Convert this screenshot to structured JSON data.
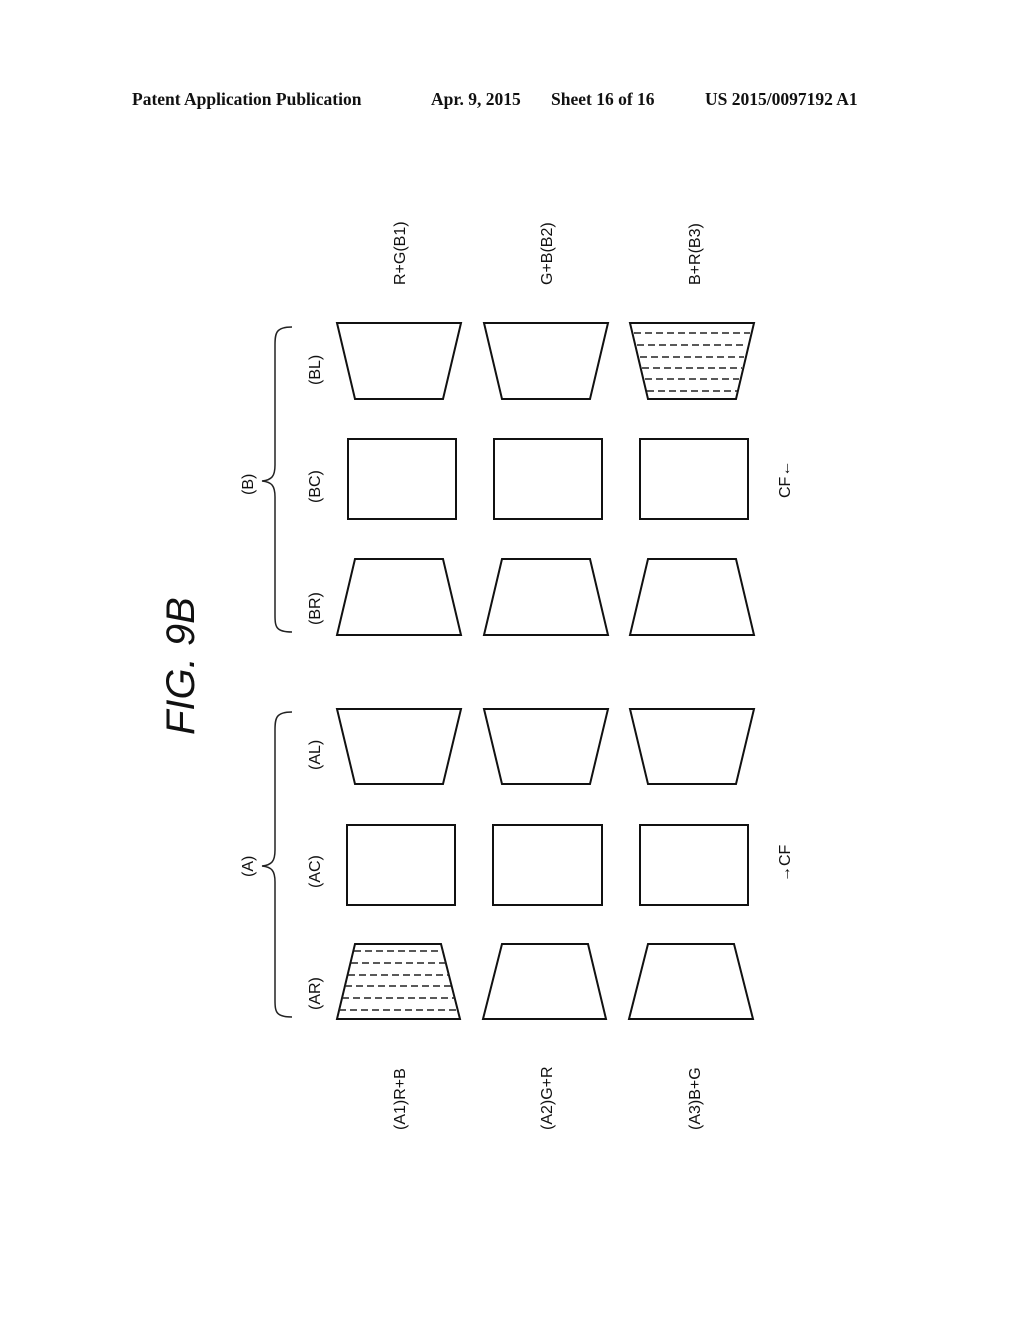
{
  "header": {
    "publication": "Patent Application Publication",
    "date": "Apr. 9, 2015",
    "sheet": "Sheet 16 of 16",
    "number": "US 2015/0097192 A1"
  },
  "figure": {
    "title": "FIG. 9B",
    "group_b": {
      "label": "(B)",
      "columns": [
        "(BL)",
        "(BC)",
        "(BR)"
      ],
      "row_labels": [
        "R+G(B1)",
        "G+B(B2)",
        "B+R(B3)"
      ],
      "cf_label": "CF←",
      "hatched_row": 3,
      "hatched_column": "(BL)"
    },
    "group_a": {
      "label": "(A)",
      "columns": [
        "(AL)",
        "(AC)",
        "(AR)"
      ],
      "row_labels": [
        "(A1)R+B",
        "(A2)G+R",
        "(A3)B+G"
      ],
      "cf_label": "→CF",
      "hatched_row": 1,
      "hatched_column": "(AR)"
    },
    "shape_types": {
      "L": "trapezoid-wide-top",
      "C": "rectangle",
      "R": "trapezoid-wide-bottom"
    }
  }
}
